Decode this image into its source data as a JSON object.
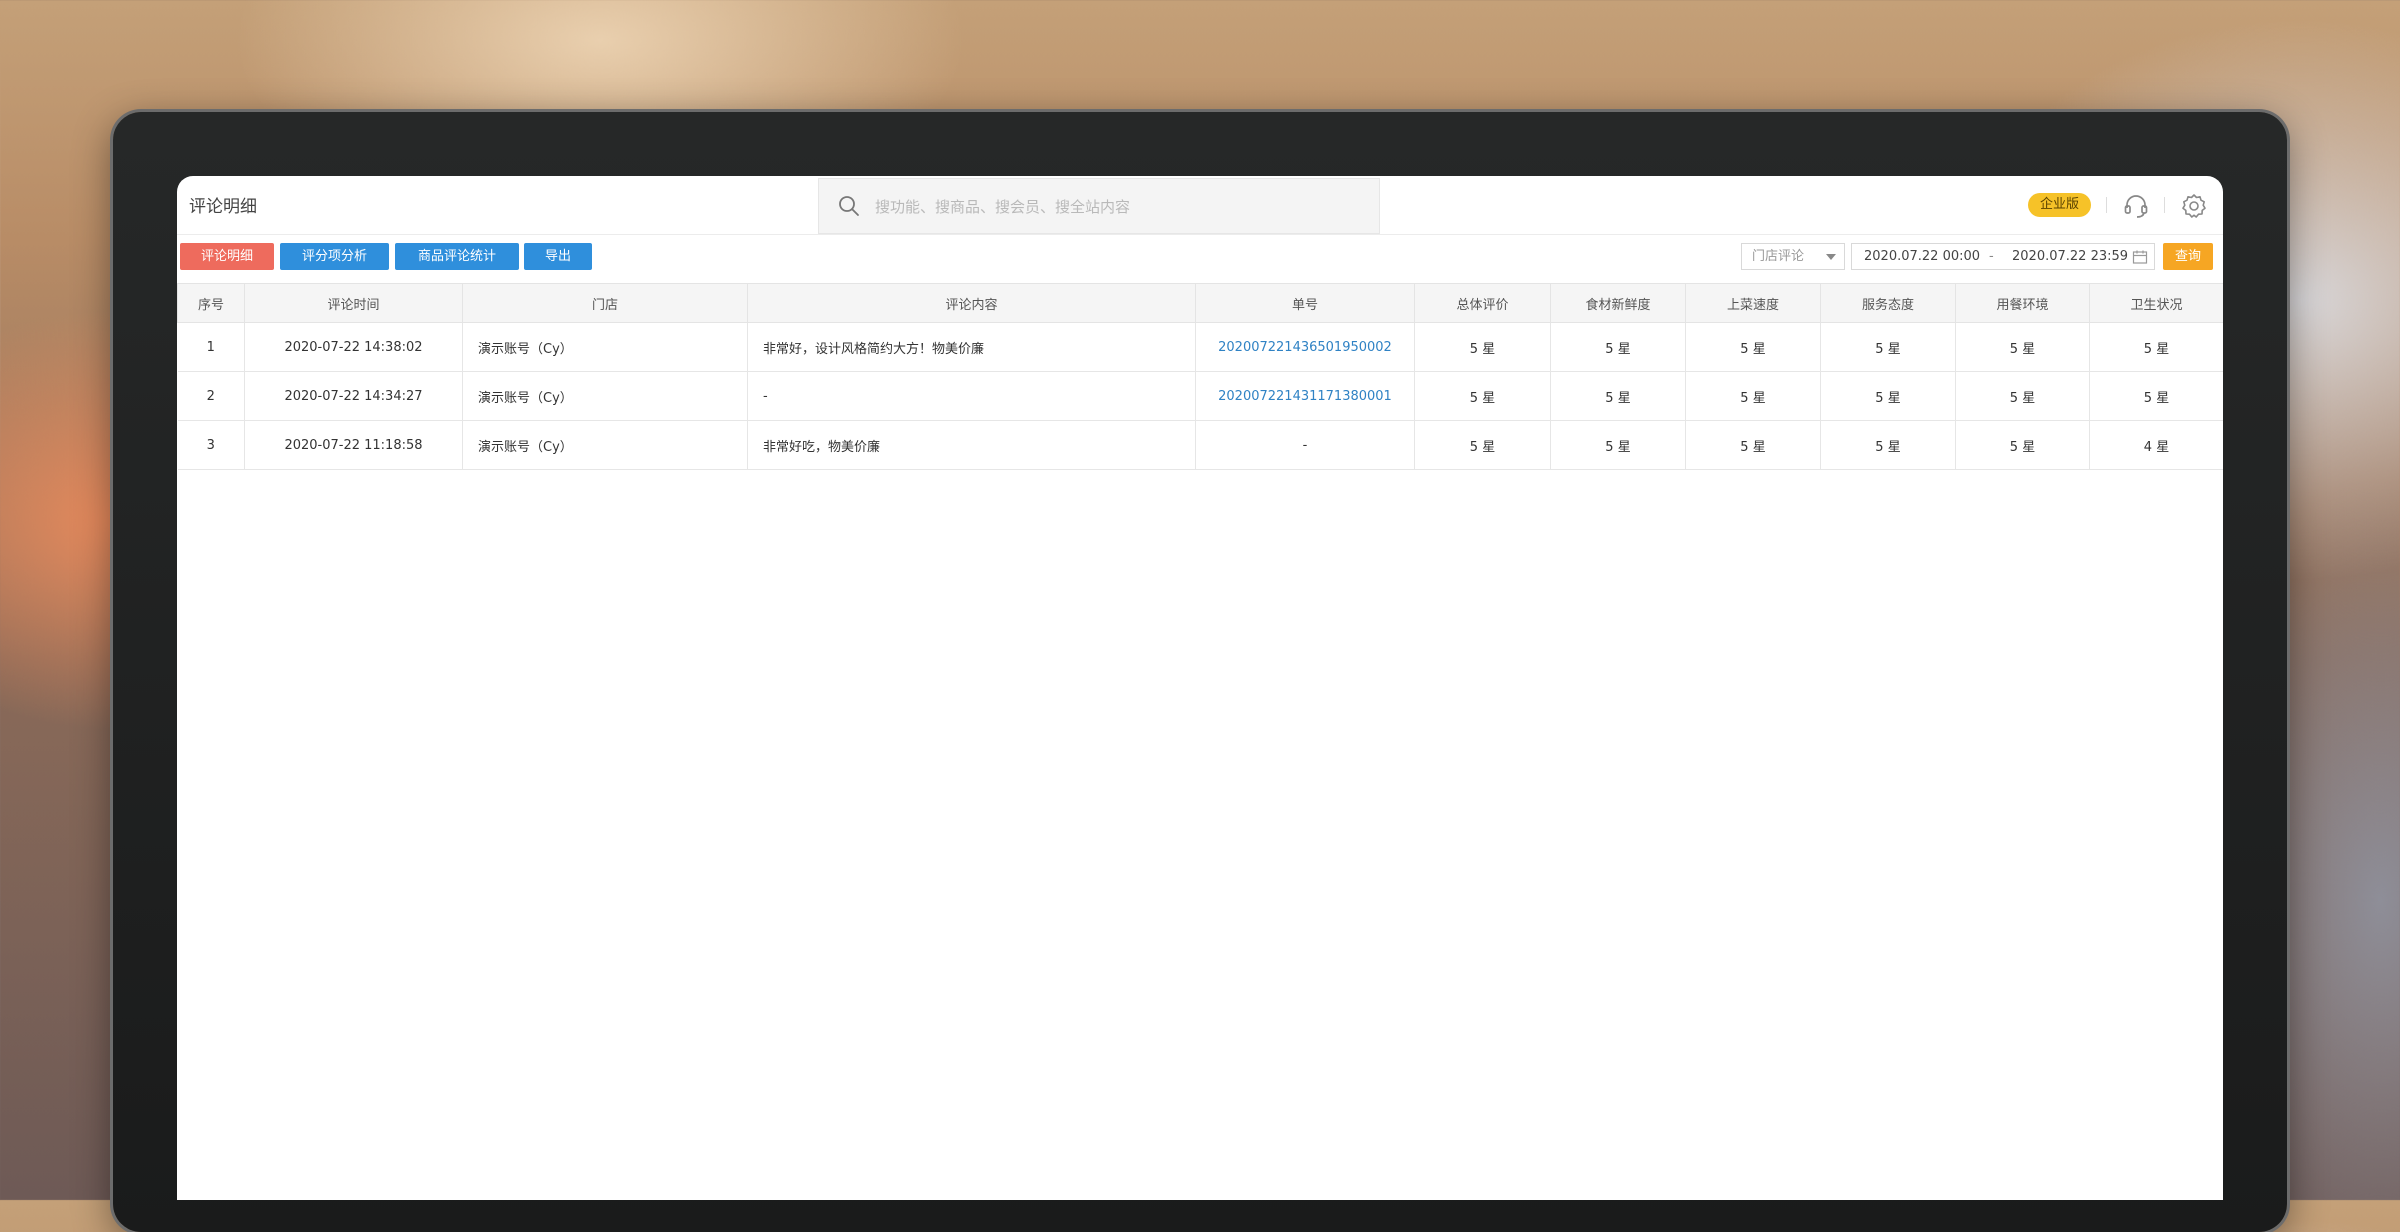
{
  "header": {
    "title": "评论明细",
    "search_placeholder": "搜功能、搜商品、搜会员、搜全站内容",
    "badge": "企业版",
    "icons": [
      "search-icon",
      "headset-icon",
      "gear-icon"
    ]
  },
  "toolbar": {
    "tabs": [
      "评论明细",
      "评分项分析",
      "商品评论统计"
    ],
    "export_label": "导出",
    "store_select": "门店评论",
    "date_start": "2020.07.22 00:00",
    "date_sep": "-",
    "date_end": "2020.07.22 23:59",
    "query_label": "查询"
  },
  "colors": {
    "active_tab": "#ee6b5d",
    "tab": "#2f8fdc",
    "query": "#f6a623",
    "badge": "#f6c228",
    "link": "#2f82c4"
  },
  "table": {
    "columns": [
      "序号",
      "评论时间",
      "门店",
      "评论内容",
      "单号",
      "总体评价",
      "食材新鲜度",
      "上菜速度",
      "服务态度",
      "用餐环境",
      "卫生状况"
    ],
    "rows": [
      [
        "1",
        "2020-07-22 14:38:02",
        "演示账号（Cy）",
        "非常好，设计风格简约大方！物美价廉",
        "20200722143650195000​2",
        "5 星",
        "5 星",
        "5 星",
        "5 星",
        "5 星",
        "5 星"
      ],
      [
        "2",
        "2020-07-22 14:34:27",
        "演示账号（Cy）",
        "-",
        "202007221431171380001",
        "5 星",
        "5 星",
        "5 星",
        "5 星",
        "5 星",
        "5 星"
      ],
      [
        "3",
        "2020-07-22 11:18:58",
        "演示账号（Cy）",
        "非常好吃，物美价廉",
        "-",
        "5 星",
        "5 星",
        "5 星",
        "5 星",
        "5 星",
        "4 星"
      ]
    ]
  }
}
